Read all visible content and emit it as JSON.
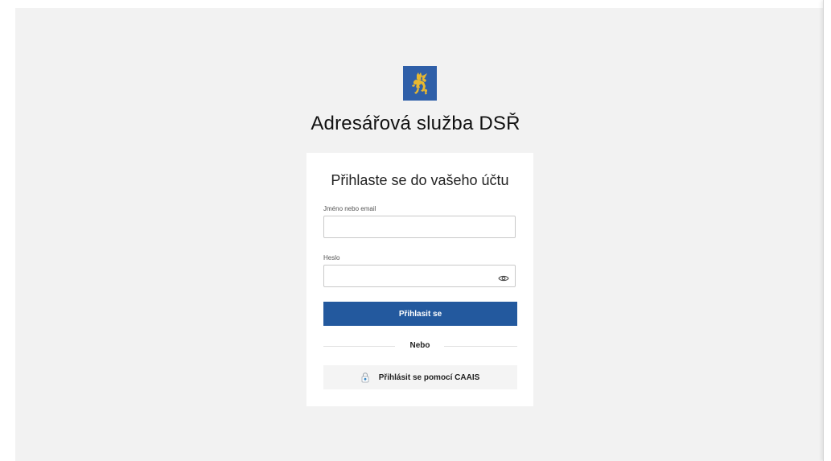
{
  "page": {
    "app_title": "Adresářová služba DSŘ"
  },
  "login": {
    "title": "Přihlaste se do vašeho účtu",
    "username_label": "Jméno nebo email",
    "username_value": "",
    "password_label": "Heslo",
    "password_value": "",
    "submit_label": "Přihlasit se",
    "divider_label": "Nebo",
    "caais_label": "Přihlásit se pomocí CAAIS"
  },
  "icons": {
    "logo": "czech-lion-coat-of-arms",
    "password_toggle": "eye-icon",
    "caais": "lock-icon"
  },
  "colors": {
    "background": "#f2f2f2",
    "primary": "#23599e",
    "logo_bg": "#2f5fa8",
    "logo_fg": "#e8b830"
  }
}
